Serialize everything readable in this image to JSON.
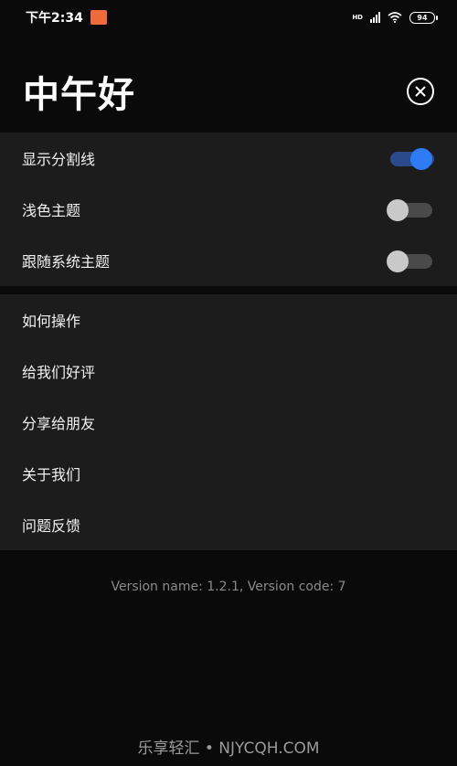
{
  "status_bar": {
    "time": "下午2:34",
    "network_type": "HD",
    "battery": "94",
    "icons": [
      "notification-icon",
      "signal-icon",
      "wifi-icon",
      "battery-icon"
    ]
  },
  "header": {
    "title": "中午好",
    "close_icon": "close-circle-icon"
  },
  "settings": {
    "items": [
      {
        "label": "显示分割线",
        "enabled": true
      },
      {
        "label": "浅色主题",
        "enabled": false
      },
      {
        "label": "跟随系统主题",
        "enabled": false
      }
    ]
  },
  "menu": {
    "items": [
      {
        "label": "如何操作"
      },
      {
        "label": "给我们好评"
      },
      {
        "label": "分享给朋友"
      },
      {
        "label": "关于我们"
      },
      {
        "label": "问题反馈"
      }
    ]
  },
  "version": "Version name: 1.2.1, Version code: 7",
  "watermark": "乐享轻汇 • NJYCQH.COM",
  "colors": {
    "background": "#0a0a0a",
    "panel": "#1c1c1c",
    "accent": "#2f7bf5"
  }
}
